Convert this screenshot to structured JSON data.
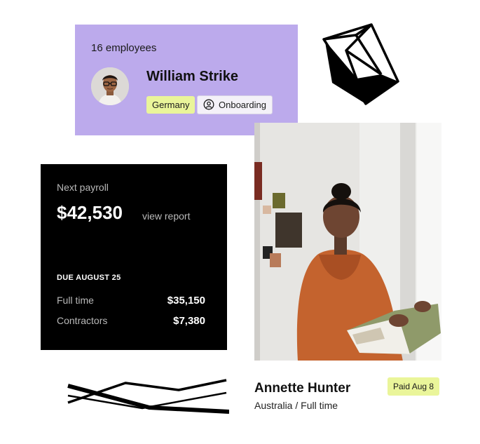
{
  "employee_card": {
    "count_text": "16 employees",
    "name": "William Strike",
    "country_tag": "Germany",
    "status_tag": "Onboarding",
    "status_icon": "user-circle-icon",
    "background_color": "#bcaaec",
    "tag_color": "#eaf59a"
  },
  "payroll_card": {
    "label": "Next payroll",
    "amount": "$42,530",
    "report_link": "view report",
    "due_label": "DUE AUGUST 25",
    "rows": [
      {
        "label": "Full time",
        "value": "$35,150"
      },
      {
        "label": "Contractors",
        "value": "$7,380"
      }
    ],
    "background_color": "#000000"
  },
  "person_card": {
    "name": "Annette Hunter",
    "subtitle": "Australia / Full time",
    "paid_badge": "Paid Aug 8",
    "badge_color": "#eaf59a"
  }
}
